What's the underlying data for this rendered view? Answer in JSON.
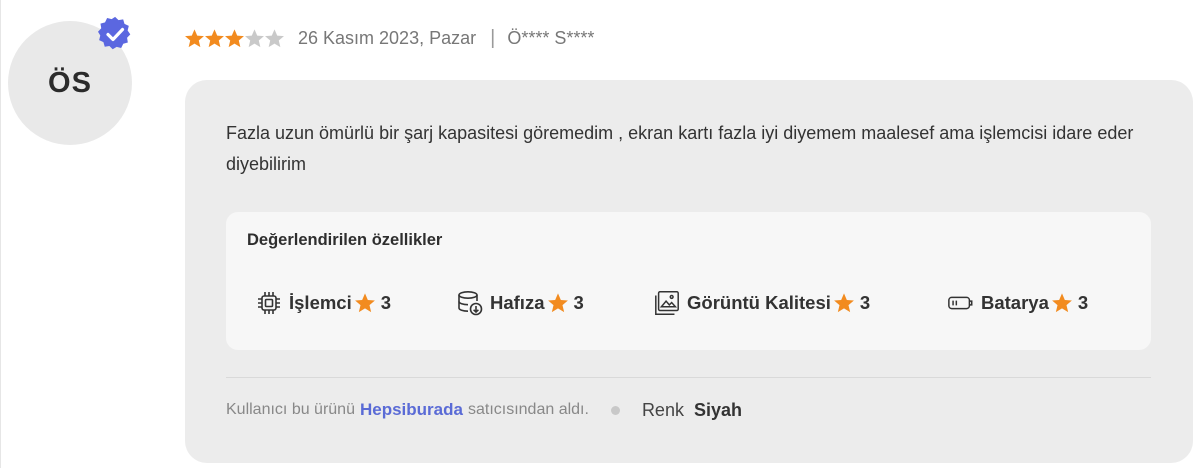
{
  "review": {
    "avatar_initials": "ÖS",
    "rating": 3,
    "max_rating": 5,
    "date": "26 Kasım 2023, Pazar",
    "separator": "|",
    "reviewer": "Ö**** S****",
    "comment": "Fazla uzun ömürlü bir şarj kapasitesi göremedim , ekran kartı fazla iyi diyemem maalesef ama işlemcisi idare eder diyebilirim"
  },
  "features": {
    "title": "Değerlendirilen özellikler",
    "items": [
      {
        "label": "İşlemci",
        "score": "3",
        "icon": "cpu-icon"
      },
      {
        "label": "Hafıza",
        "score": "3",
        "icon": "storage-icon"
      },
      {
        "label": "Görüntü Kalitesi",
        "score": "3",
        "icon": "image-icon"
      },
      {
        "label": "Batarya",
        "score": "3",
        "icon": "battery-icon"
      }
    ]
  },
  "footer": {
    "purchase_prefix": "Kullanıcı bu ürünü",
    "seller": "Hepsiburada",
    "purchase_suffix": "satıcısından aldı.",
    "attribute_name": "Renk",
    "attribute_value": "Siyah"
  },
  "colors": {
    "star_filled": "#f28b1f",
    "star_empty": "#c9c9c9",
    "verified_badge": "#5b67e0",
    "seller_link": "#5a6bd6"
  }
}
